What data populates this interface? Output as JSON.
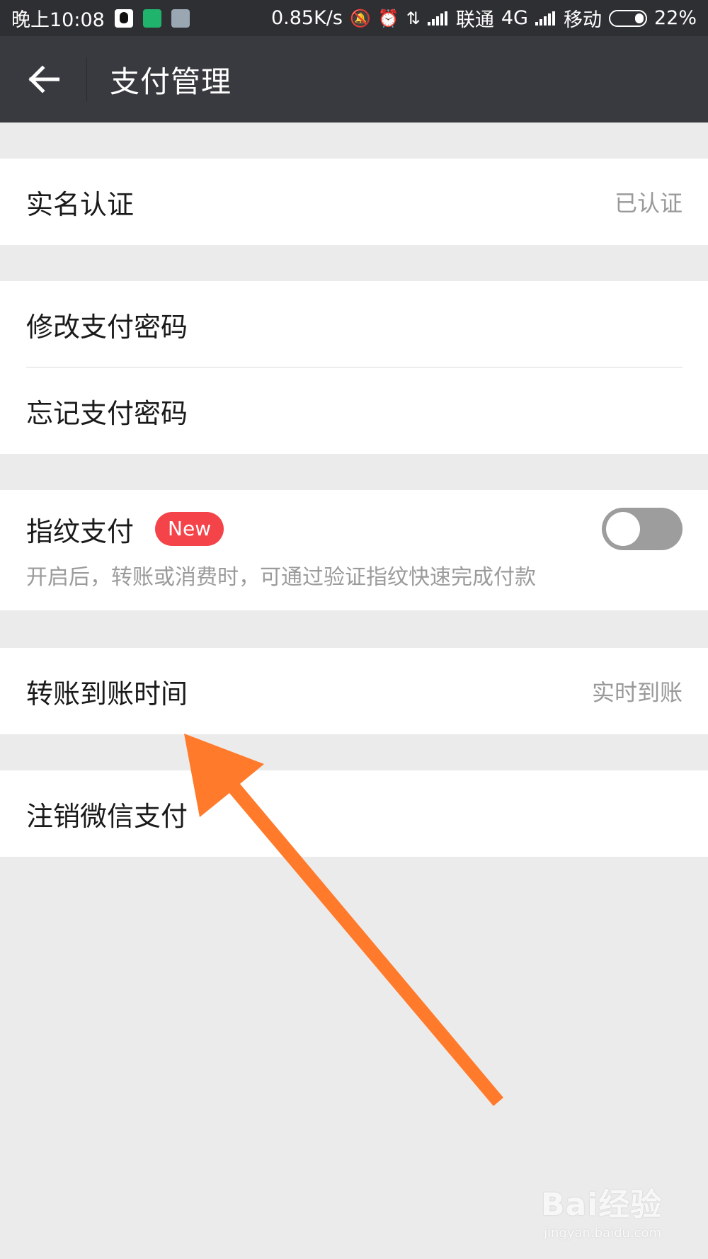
{
  "status_bar": {
    "time": "晚上10:08",
    "network_speed": "0.85K/s",
    "carrier_1": "联通",
    "network_type": "4G",
    "carrier_2": "移动",
    "battery": "22%"
  },
  "title_bar": {
    "title": "支付管理"
  },
  "sections": {
    "real_name": {
      "label": "实名认证",
      "value": "已认证"
    },
    "change_password": {
      "label": "修改支付密码"
    },
    "forgot_password": {
      "label": "忘记支付密码"
    },
    "fingerprint": {
      "label": "指纹支付",
      "badge": "New",
      "toggle_on": false,
      "description": "开启后，转账或消费时，可通过验证指纹快速完成付款"
    },
    "transfer_time": {
      "label": "转账到账时间",
      "value": "实时到账"
    },
    "deactivate": {
      "label": "注销微信支付"
    }
  },
  "annotation": {
    "arrow_color": "#ff7a2a"
  },
  "watermark": {
    "logo": "Bai经验",
    "url": "jingyan.baidu.com"
  }
}
